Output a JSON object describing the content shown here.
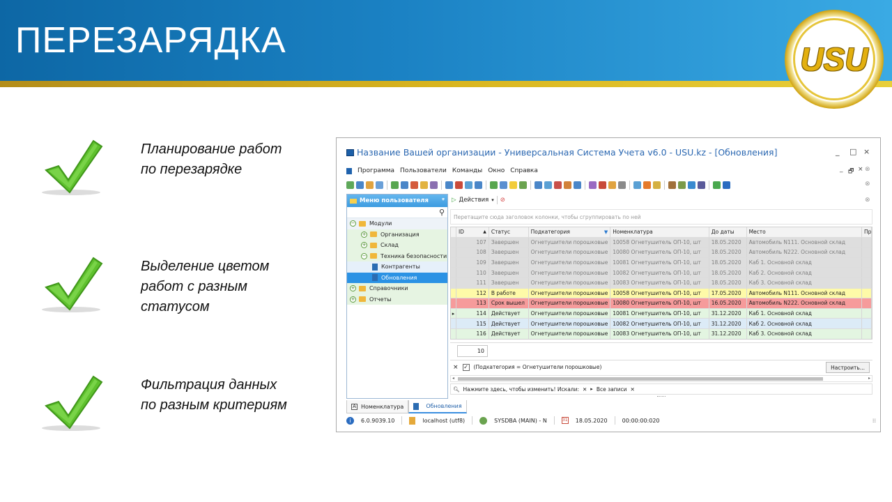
{
  "slide": {
    "title": "ПЕРЕЗАРЯДКА",
    "logo_text": "USU",
    "bullets": [
      {
        "line1": "Планирование работ",
        "line2": "по перезарядке",
        "line3": ""
      },
      {
        "line1": "Выделение цветом",
        "line2": "работ с разным",
        "line3": "статусом"
      },
      {
        "line1": "Фильтрация данных",
        "line2": "по разным критериям",
        "line3": ""
      }
    ]
  },
  "window": {
    "title": "Название Вашей организации - Универсальная Система Учета v6.0 - USU.kz - [Обновления]",
    "controls": {
      "minimize": "_",
      "maximize": "□",
      "close": "×"
    },
    "menu": [
      "Программа",
      "Пользователи",
      "Команды",
      "Окно",
      "Справка"
    ],
    "mdi_controls": {
      "minimize": "_",
      "restore": "🗗",
      "close": "×"
    },
    "toolbar_icon_colors": [
      "#5fa85a",
      "#4a86c8",
      "#e0a340",
      "#6aa0d8",
      "#58a64f",
      "#4a86c8",
      "#d45a3c",
      "#e2b340",
      "#8a6fb0",
      "#4a86c8",
      "#c94a3a",
      "#5aa0d4",
      "#4a86c8",
      "#58a64f",
      "#5b8fd0",
      "#f2cc3a",
      "#6aa34f",
      "#4a86c8",
      "#5aa0d4",
      "#c8504a",
      "#d2823a",
      "#4a86c8",
      "#9a6ac2",
      "#c84a3a",
      "#e0a340",
      "#8a8a8a",
      "#5aa0d4",
      "#e57a2a",
      "#d4b040",
      "#a0703a",
      "#7a9a4a",
      "#3a8ad0",
      "#5a5a9a",
      "#4aa84f",
      "#2a6cc0"
    ]
  },
  "left_panel": {
    "header": "Меню пользователя",
    "pin": "ᵠ",
    "search_icon": "search-icon",
    "tree": [
      {
        "label": "Модули",
        "level": 0,
        "expander": "⊖",
        "icon": "folder",
        "bg": "#eef3f8",
        "selected": false
      },
      {
        "label": "Организация",
        "level": 1,
        "expander": "⊕",
        "icon": "folder",
        "bg": "#e6f4e2",
        "selected": false
      },
      {
        "label": "Склад",
        "level": 1,
        "expander": "⊕",
        "icon": "folder",
        "bg": "#e6f4e2",
        "selected": false
      },
      {
        "label": "Техника безопасности",
        "level": 1,
        "expander": "⊖",
        "icon": "folder",
        "bg": "#e6f4e2",
        "selected": false
      },
      {
        "label": "Контрагенты",
        "level": 2,
        "expander": "",
        "icon": "doc",
        "bg": "#e6f0fa",
        "selected": false
      },
      {
        "label": "Обновления",
        "level": 2,
        "expander": "",
        "icon": "doc",
        "bg": "#2b92e4",
        "selected": true
      },
      {
        "label": "Справочники",
        "level": 0,
        "expander": "⊕",
        "icon": "folder",
        "bg": "#e6f4e2",
        "selected": false
      },
      {
        "label": "Отчеты",
        "level": 0,
        "expander": "⊕",
        "icon": "folder",
        "bg": "#e6f4e2",
        "selected": false
      }
    ]
  },
  "grid": {
    "actions_label": "Действия",
    "group_hint": "Перетащите сюда заголовок колонки, чтобы сгруппировать по ней",
    "columns": [
      "ID",
      "Статус",
      "Подкатегория",
      "Номенклатура",
      "До даты",
      "Место",
      "Пр"
    ],
    "rows": [
      {
        "id": "107",
        "status": "Завершен",
        "sub": "Огнетушители порошковые",
        "nom": "10058 Огнетушитель ОП-10, шт",
        "date": "18.05.2020",
        "place": "Автомобиль N111. Основной склад",
        "cls": "r-done",
        "mark": ""
      },
      {
        "id": "108",
        "status": "Завершен",
        "sub": "Огнетушители порошковые",
        "nom": "10080 Огнетушитель ОП-10, шт",
        "date": "18.05.2020",
        "place": "Автомобиль N222. Основной склад",
        "cls": "r-done",
        "mark": ""
      },
      {
        "id": "109",
        "status": "Завершен",
        "sub": "Огнетушители порошковые",
        "nom": "10081 Огнетушитель ОП-10, шт",
        "date": "18.05.2020",
        "place": "Каб 1. Основной склад",
        "cls": "r-done",
        "mark": ""
      },
      {
        "id": "110",
        "status": "Завершен",
        "sub": "Огнетушители порошковые",
        "nom": "10082 Огнетушитель ОП-10, шт",
        "date": "18.05.2020",
        "place": "Каб 2. Основной склад",
        "cls": "r-done",
        "mark": ""
      },
      {
        "id": "111",
        "status": "Завершен",
        "sub": "Огнетушители порошковые",
        "nom": "10083 Огнетушитель ОП-10, шт",
        "date": "18.05.2020",
        "place": "Каб 3. Основной склад",
        "cls": "r-done",
        "mark": ""
      },
      {
        "id": "112",
        "status": "В работе",
        "sub": "Огнетушители порошковые",
        "nom": "10058 Огнетушитель ОП-10, шт",
        "date": "17.05.2020",
        "place": "Автомобиль N111. Основной склад",
        "cls": "r-work",
        "mark": ""
      },
      {
        "id": "113",
        "status": "Срок вышел",
        "sub": "Огнетушители порошковые",
        "nom": "10080 Огнетушитель ОП-10, шт",
        "date": "16.05.2020",
        "place": "Автомобиль N222. Основной склад",
        "cls": "r-late",
        "mark": ""
      },
      {
        "id": "114",
        "status": "Действует",
        "sub": "Огнетушители порошковые",
        "nom": "10081 Огнетушитель ОП-10, шт",
        "date": "31.12.2020",
        "place": "Каб 1. Основной склад",
        "cls": "r-act",
        "mark": "▸"
      },
      {
        "id": "115",
        "status": "Действует",
        "sub": "Огнетушители порошковые",
        "nom": "10082 Огнетушитель ОП-10, шт",
        "date": "31.12.2020",
        "place": "Каб 2. Основной склад",
        "cls": "r-sel",
        "mark": ""
      },
      {
        "id": "116",
        "status": "Действует",
        "sub": "Огнетушители порошковые",
        "nom": "10083 Огнетушитель ОП-10, шт",
        "date": "31.12.2020",
        "place": "Каб 3. Основной склад",
        "cls": "r-act",
        "mark": ""
      }
    ],
    "row_count": "10",
    "filter_text": "(Подкатегория = Огнетушители порошковые)",
    "customize_label": "Настроить...",
    "find_hint": "Нажмите здесь, чтобы изменить! Искали:",
    "all_records": "Все записи"
  },
  "tabs": [
    {
      "label": "Номенклатура",
      "active": false
    },
    {
      "label": "Обновления",
      "active": true
    }
  ],
  "status": {
    "version": "6.0.9039.10",
    "server": "localhost (utf8)",
    "user": "SYSDBA (MAIN) - N",
    "date": "18.05.2020",
    "timer": "00:00:00:020"
  }
}
